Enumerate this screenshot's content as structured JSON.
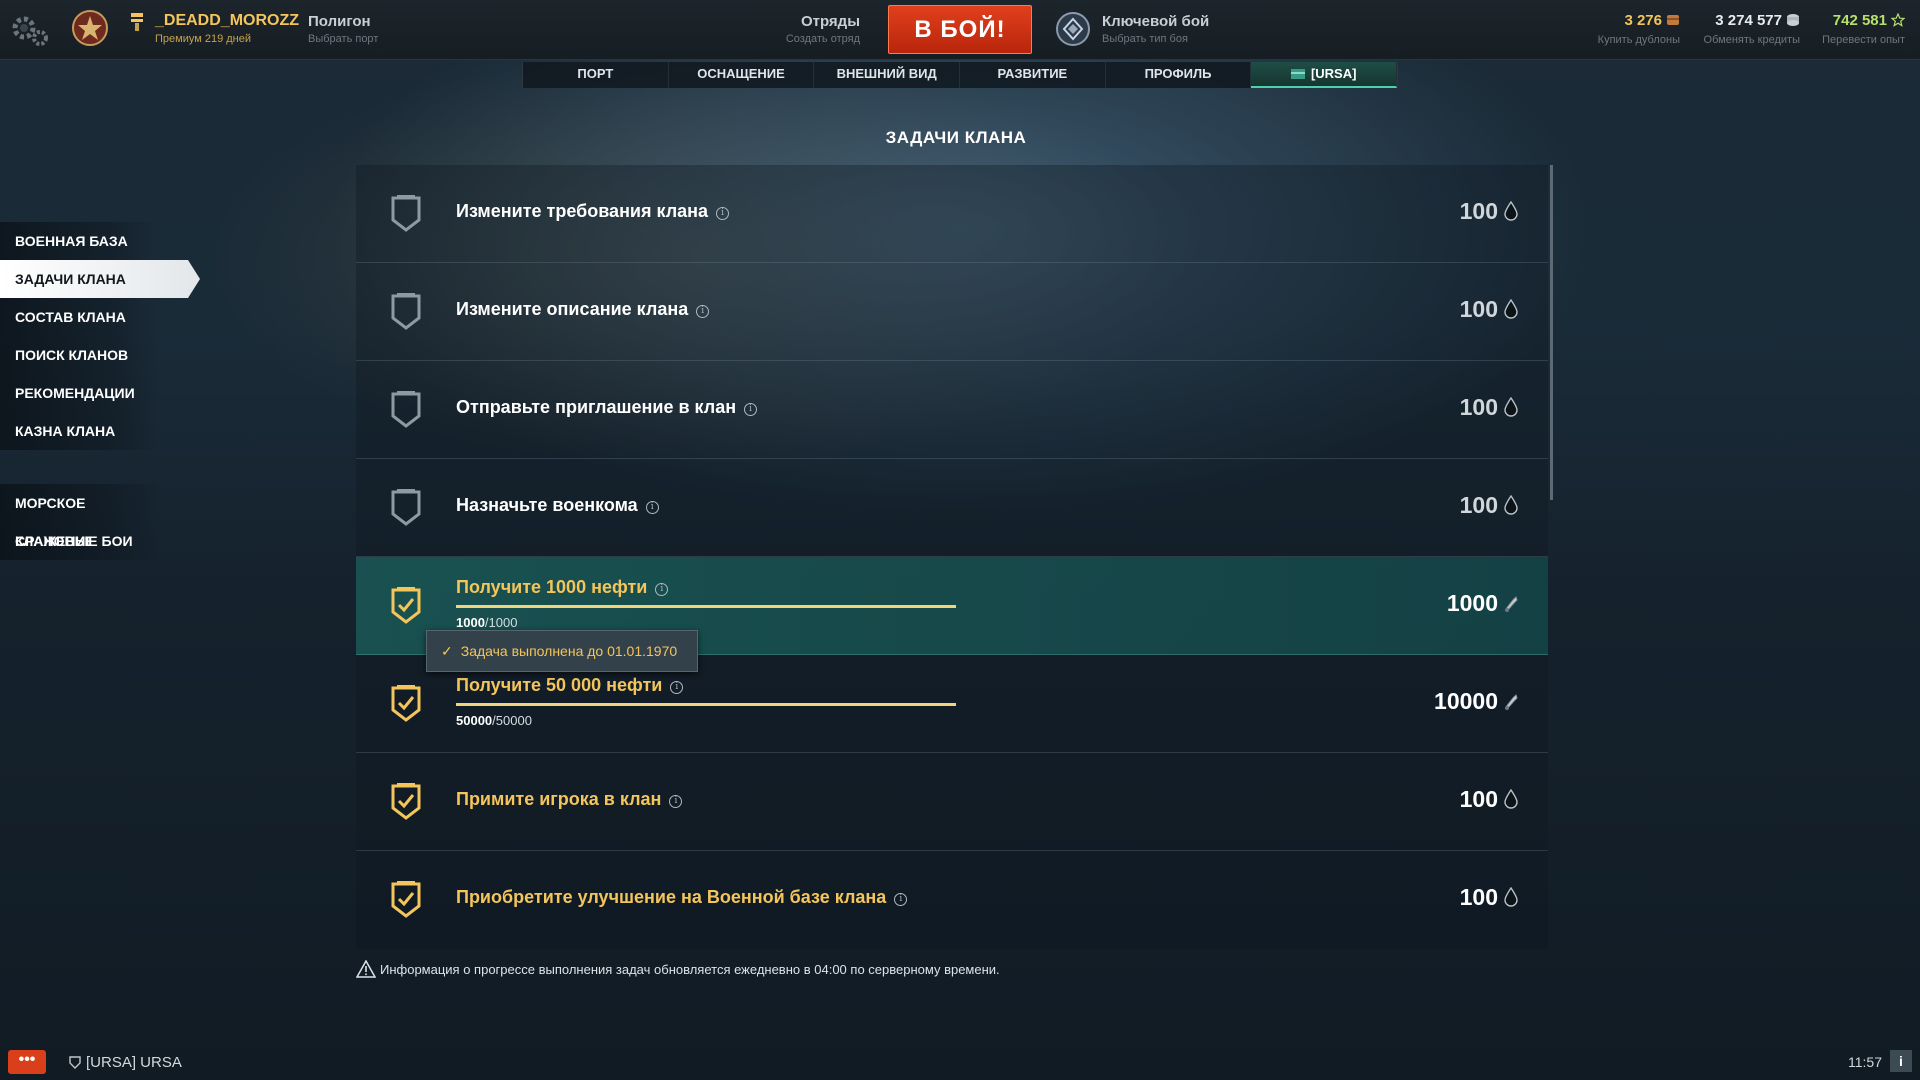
{
  "header": {
    "player_name": "_DEADD_MOROZZ",
    "premium": "Премиум 219 дней",
    "mode_title": "Полигон",
    "mode_sub": "Выбрать порт",
    "squad_title": "Отряды",
    "squad_sub": "Создать отряд",
    "battle_button": "В БОЙ!",
    "battle_type_title": "Ключевой бой",
    "battle_type_sub": "Выбрать тип боя",
    "doubloons": "3 276",
    "doubloons_sub": "Купить дублоны",
    "credits": "3 274 577",
    "credits_sub": "Обменять кредиты",
    "free_xp": "742 581",
    "free_xp_sub": "Перевести опыт"
  },
  "tabs": [
    "ПОРТ",
    "ОСНАЩЕНИЕ",
    "ВНЕШНИЙ ВИД",
    "РАЗВИТИЕ",
    "ПРОФИЛЬ",
    "[URSA]"
  ],
  "sidebar": {
    "group1": [
      "ВОЕННАЯ БАЗА",
      "ЗАДАЧИ КЛАНА",
      "СОСТАВ КЛАНА",
      "ПОИСК КЛАНОВ",
      "РЕКОМЕНДАЦИИ",
      "КАЗНА КЛАНА"
    ],
    "group2": [
      "МОРСКОЕ СРАЖЕНИЕ",
      "КЛАНОВЫЕ БОИ"
    ],
    "active": "ЗАДАЧИ КЛАНА"
  },
  "page_title": "ЗАДАЧИ КЛАНА",
  "tasks": [
    {
      "title": "Измените требования клана",
      "reward": "100",
      "reward_type": "oil",
      "done": false
    },
    {
      "title": "Измените описание клана",
      "reward": "100",
      "reward_type": "oil",
      "done": false
    },
    {
      "title": "Отправьте приглашение в клан",
      "reward": "100",
      "reward_type": "oil",
      "done": false
    },
    {
      "title": "Назначьте военкома",
      "reward": "100",
      "reward_type": "oil",
      "done": false
    },
    {
      "title": "Получите 1000 нефти",
      "reward": "1000",
      "reward_type": "tool",
      "done": true,
      "progress": 1.0,
      "progress_current": "1000",
      "progress_total": "/1000"
    },
    {
      "title": "Получите 50 000 нефти",
      "reward": "10000",
      "reward_type": "tool",
      "done": true,
      "progress": 1.0,
      "progress_current": "50000",
      "progress_total": "/50000"
    },
    {
      "title": "Примите игрока в клан",
      "reward": "100",
      "reward_type": "oil",
      "done": true
    },
    {
      "title": "Приобретите улучшение на Военной базе клана",
      "reward": "100",
      "reward_type": "oil",
      "done": true
    }
  ],
  "tooltip": "Задача выполнена до 01.01.1970",
  "notice": "Информация о прогрессе выполнения задач обновляется ежедневно в 04:00 по серверному времени.",
  "footer": {
    "chat_button": "•••",
    "clan_chat": "[URSA] URSA",
    "clock": "11:57",
    "info_button": "i"
  },
  "colors": {
    "accent_gold": "#f3c55a",
    "battle_red": "#d9391a",
    "highlight_teal": "#1a5654",
    "free_xp_green": "#b6e06b"
  }
}
